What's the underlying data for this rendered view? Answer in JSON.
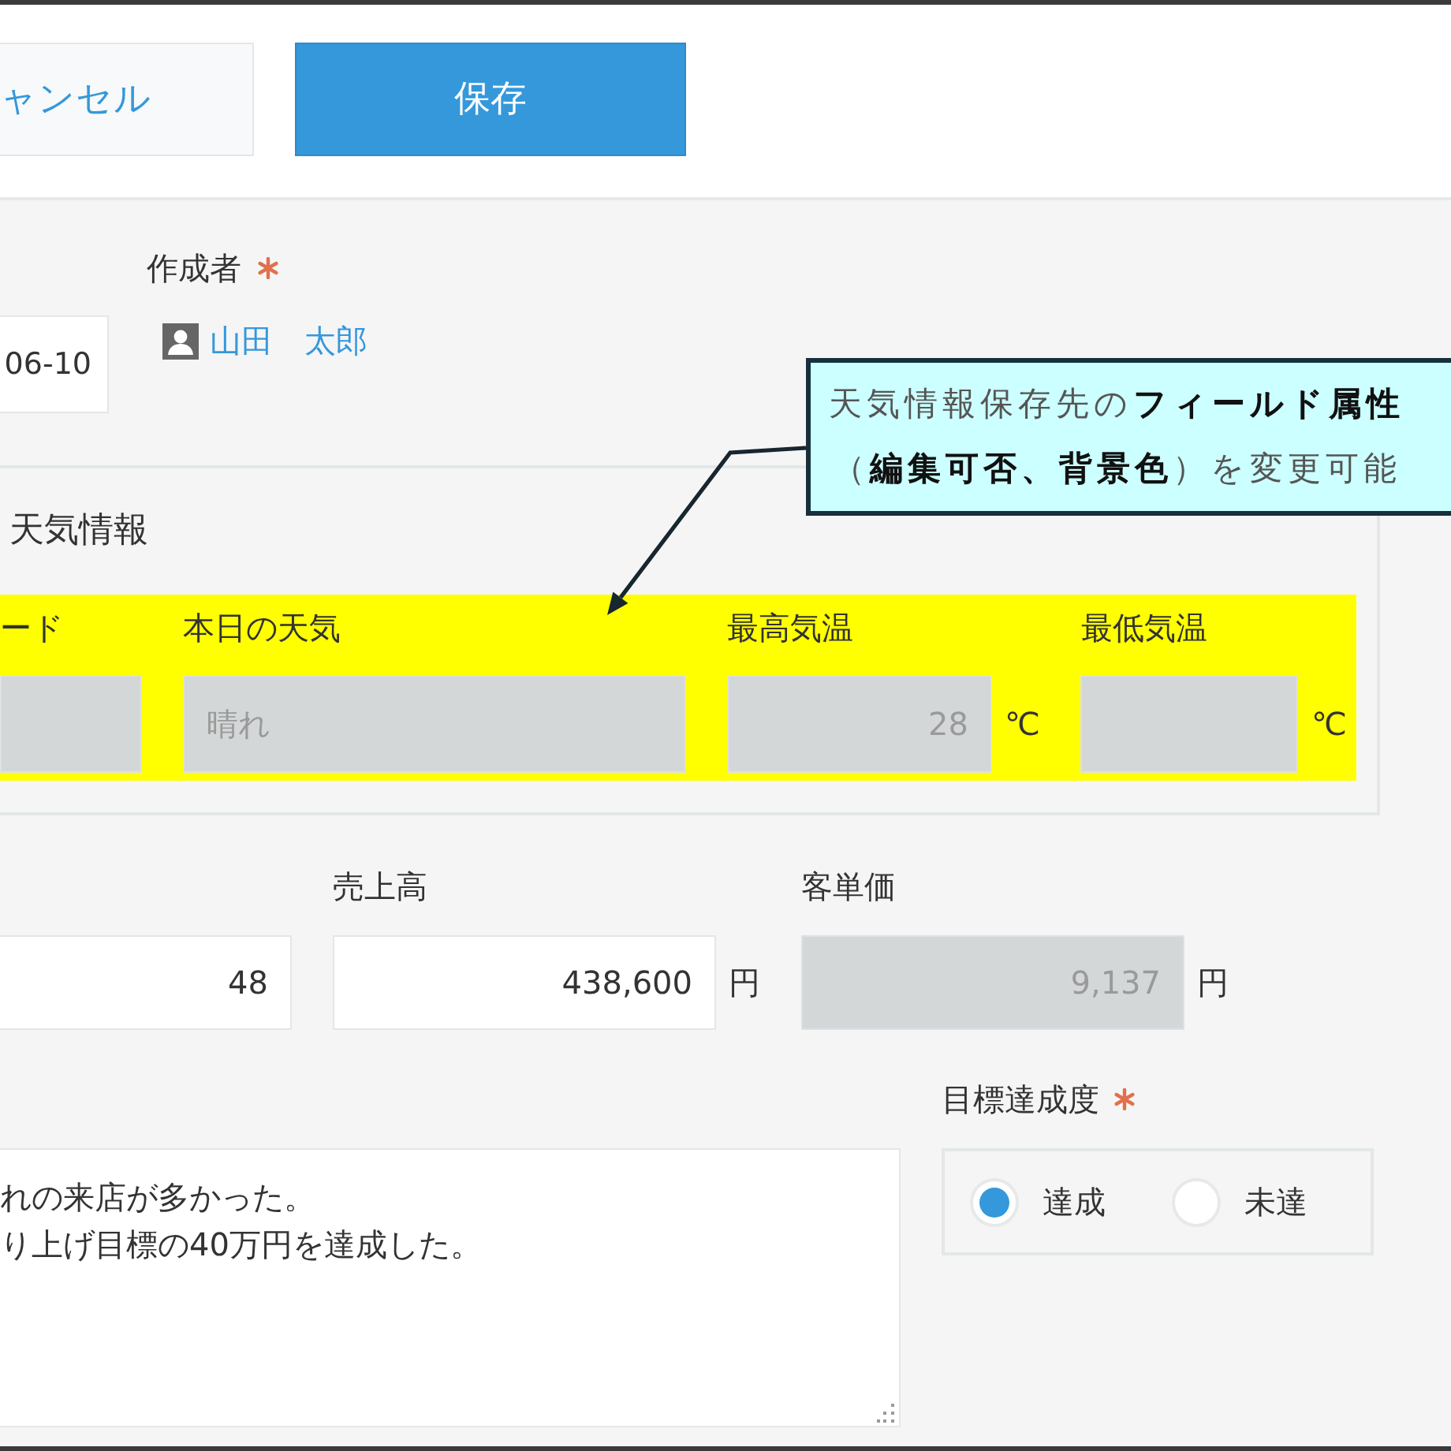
{
  "toolbar": {
    "buttons": [
      {
        "label": "ャンセル",
        "kind": "cancel"
      },
      {
        "label": "保存",
        "kind": "save"
      }
    ]
  },
  "author_row": {
    "date_field": {
      "value": "06-10",
      "kind": "date"
    },
    "author": {
      "label": "作成者",
      "required": true,
      "user": "山田　太郎"
    }
  },
  "weather_group": {
    "title": "天気情報",
    "highlighted": true,
    "fields": [
      {
        "label": "ード",
        "kind": "text",
        "disabled": true
      },
      {
        "label": "本日の天気",
        "kind": "text",
        "value": "晴れ",
        "disabled": true
      },
      {
        "label": "最高気温",
        "kind": "number",
        "value": "28",
        "unit": "℃",
        "disabled": true
      },
      {
        "label": "最低気温",
        "kind": "number",
        "unit": "℃",
        "disabled": true
      }
    ]
  },
  "sales_row": {
    "fields": [
      {
        "kind": "number",
        "value": "48",
        "disabled": false
      },
      {
        "label": "売上高",
        "kind": "number",
        "value": "438,600",
        "unit": "円",
        "disabled": false
      },
      {
        "label": "客単価",
        "kind": "number",
        "value": "9,137",
        "unit": "円",
        "disabled": true
      }
    ]
  },
  "memo_row": {
    "textarea": {
      "lines": [
        "れの来店が多かった。",
        "り上げ目標の40万円を達成した。"
      ]
    },
    "goal": {
      "label": "目標達成度",
      "required": true,
      "options": [
        {
          "label": "達成",
          "selected": true
        },
        {
          "label": "未達",
          "selected": false
        }
      ]
    }
  },
  "annotation": {
    "lines": [
      "天気情報保存先の**フィールド属性**",
      "（**編集可否、背景色**）を変更可能"
    ]
  }
}
